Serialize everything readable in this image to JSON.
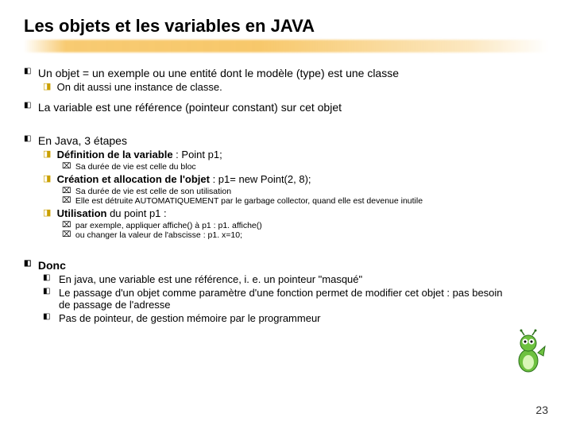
{
  "title": "Les objets et les variables en JAVA",
  "items": {
    "l1a": "Un objet = un exemple ou une entité dont le modèle (type) est une classe",
    "l2a": "On dit aussi une instance de classe.",
    "l1b": "La variable est une référence (pointeur constant) sur cet objet",
    "l1c": "En Java, 3 étapes",
    "def_label": "Définition de la variable",
    "def_rest": " :  Point p1;",
    "def_sub": "Sa durée de vie est celle du bloc",
    "crea_label": "Création et allocation de l'objet",
    "crea_rest": " : p1= new Point(2, 8);",
    "crea_sub1": "Sa durée de vie est celle de son utilisation",
    "crea_sub2": "Elle est détruite AUTOMATIQUEMENT par le garbage collector, quand elle est devenue inutile",
    "util_label": "Utilisation",
    "util_rest": " du point p1 :",
    "util_sub1": "par exemple, appliquer affiche() à p1 : p1. affiche()",
    "util_sub2": "ou changer la valeur de l'abscisse : p1. x=10;",
    "donc": "Donc",
    "donc1": "En java, une variable est une référence, i. e. un pointeur \"masqué\"",
    "donc2": "Le passage d'un objet comme paramètre d'une fonction permet de modifier cet objet : pas besoin de passage de l'adresse",
    "donc3": "Pas de pointeur, de gestion mémoire par le programmeur"
  },
  "glyphs": {
    "z": "◧",
    "y": "◨",
    "x": "⌧"
  },
  "page_number": "23"
}
